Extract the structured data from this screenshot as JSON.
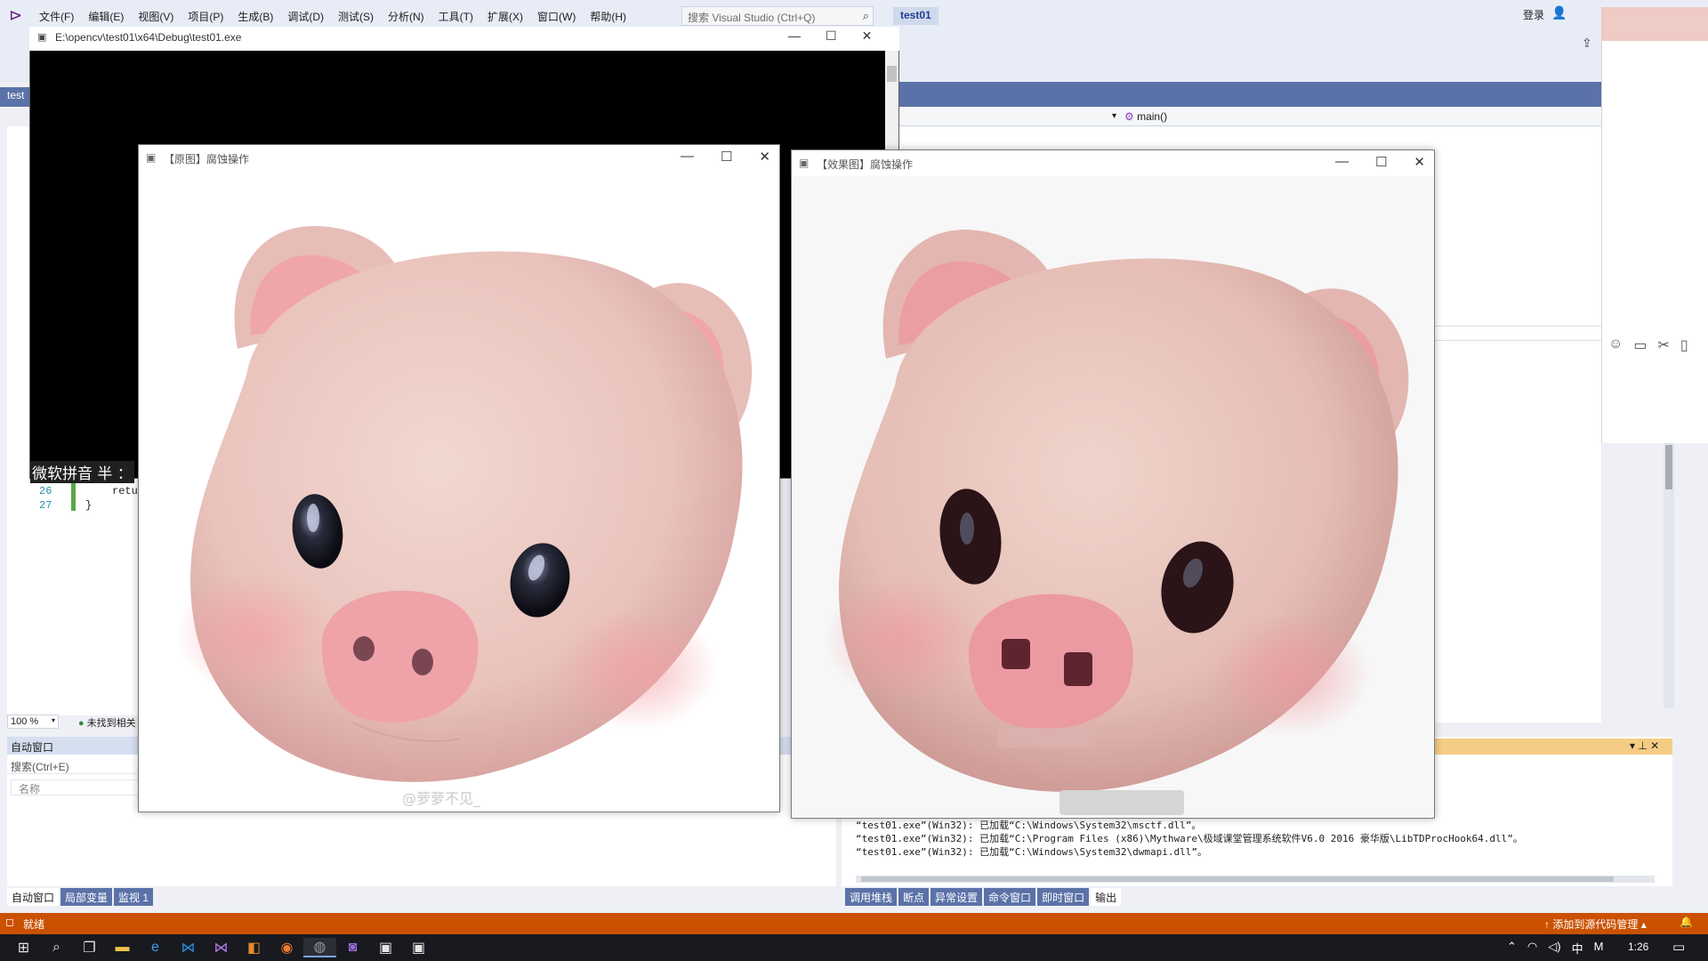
{
  "vs": {
    "menu": [
      "文件(F)",
      "编辑(E)",
      "视图(V)",
      "项目(P)",
      "生成(B)",
      "调试(D)",
      "测试(S)",
      "分析(N)",
      "工具(T)",
      "扩展(X)",
      "窗口(W)",
      "帮助(H)"
    ],
    "search_placeholder": "搜索 Visual Studio (Ctrl+Q)",
    "project_name": "test01",
    "login": "登录",
    "left_tab": "test",
    "nav_function": "main()",
    "code_lines": [
      {
        "num": "26",
        "code": "retu"
      },
      {
        "num": "27",
        "code": "}"
      }
    ],
    "ime_text": "微软拼音 半 ：",
    "zoom": "100 %",
    "status_check": "未找到相关",
    "auto_panel": {
      "title": "自动窗口",
      "search": "搜索(Ctrl+E)",
      "col_name": "名称"
    },
    "bottom_tabs_left": [
      "自动窗口",
      "局部变量",
      "监视 1"
    ],
    "bottom_tabs_right": [
      "调用堆栈",
      "断点",
      "异常设置",
      "命令窗口",
      "即时窗口",
      "输出"
    ],
    "output_lines": [
      "“test01.exe”(Win32): 已加载“C:\\Windows\\System32\\msctf.dll”。",
      "“test01.exe”(Win32): 已加载“C:\\Program Files (x86)\\Mythware\\极域课堂管理系统软件V6.0 2016 豪华版\\LibTDProcHook64.dll”。",
      "“test01.exe”(Win32): 已加载“C:\\Windows\\System32\\dwmapi.dll”。"
    ],
    "status_ready": "就绪",
    "status_source": "添加到源代码管理"
  },
  "console": {
    "title": "E:\\opencv\\test01\\x64\\Debug\\test01.exe"
  },
  "orig_window": {
    "title": "【原图】腐蚀操作",
    "watermark": "@萝萝不见_"
  },
  "eff_window": {
    "title": "【效果图】腐蚀操作"
  },
  "taskbar": {
    "apps": [
      "start-icon",
      "search-icon",
      "task-view-icon",
      "file-explorer-icon",
      "edge-icon",
      "vscode-icon",
      "visual-studio-icon",
      "app-orange-icon",
      "firefox-icon",
      "app-gray-icon",
      "app-purple-icon",
      "app-window-icon",
      "app-window2-icon"
    ],
    "ime": "中",
    "time": "1:26"
  },
  "colors": {
    "statusbar": "#ca5100",
    "vs_band": "#5b72a8",
    "output_title": "#f5cc84",
    "taskbar": "#181a1f"
  }
}
